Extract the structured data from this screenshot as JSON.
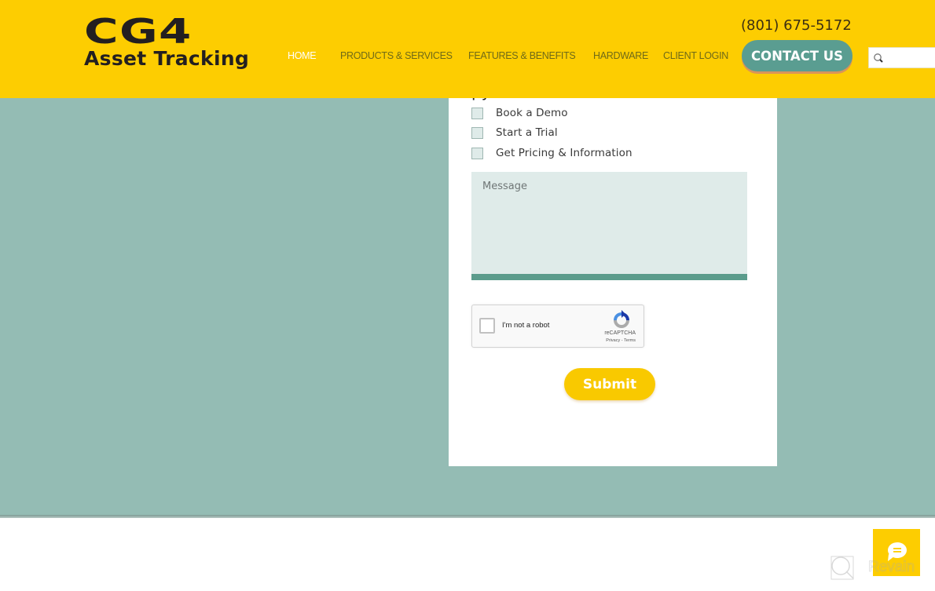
{
  "header": {
    "logo_line1": "CG4",
    "logo_line2": "Asset Tracking",
    "phone": "(801) 675-5172",
    "nav": [
      {
        "label": "HOME",
        "active": true
      },
      {
        "label": "PRODUCTS & SERVICES",
        "active": false
      },
      {
        "label": "FEATURES & BENEFITS",
        "active": false
      },
      {
        "label": "HARDWARE",
        "active": false
      },
      {
        "label": "CLIENT LOGIN",
        "active": false
      }
    ],
    "contact_label": "CONTACT US",
    "search": {
      "icon": "search-icon",
      "placeholder": "",
      "value": ""
    }
  },
  "form": {
    "partial_heading": "py",
    "options": [
      {
        "label": "Book a Demo",
        "checked": false
      },
      {
        "label": "Start a Trial",
        "checked": false
      },
      {
        "label": "Get Pricing & Information",
        "checked": false
      }
    ],
    "message": {
      "placeholder": "Message",
      "value": ""
    },
    "recaptcha": {
      "label": "I'm not a robot",
      "brand": "reCAPTCHA",
      "links": "Privacy - Terms"
    },
    "submit_label": "Submit"
  },
  "chat_widget": {
    "icon": "chat-bubble-icon"
  },
  "watermark": {
    "text": "Revain"
  },
  "colors": {
    "header_yellow": "#fdcd01",
    "teal_background": "#94bcb4",
    "contact_button": "#5a9d91",
    "field_background": "#dfebe9",
    "field_accent": "#5b9c8c",
    "submit_button": "#f9c900"
  }
}
